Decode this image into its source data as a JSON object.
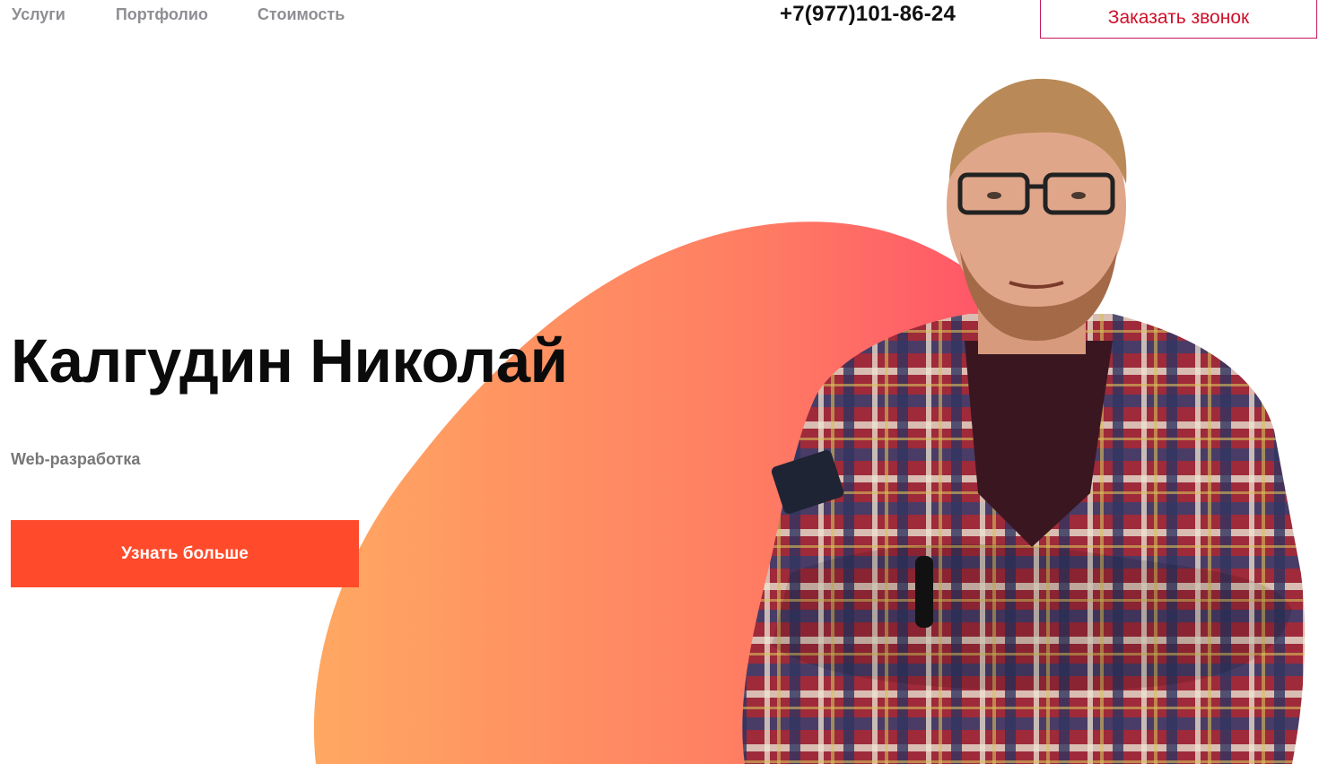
{
  "nav": {
    "items": [
      {
        "label": "Услуги"
      },
      {
        "label": "Портфолио"
      },
      {
        "label": "Стоимость"
      }
    ]
  },
  "header": {
    "phone": "+7(977)101-86-24",
    "callback_label": "Заказать звонок"
  },
  "hero": {
    "title": "Калгудин Николай",
    "subtitle": "Web-разработка",
    "cta_label": "Узнать больше"
  },
  "colors": {
    "accent": "#ff4b2b",
    "blob_start": "#ffa25c",
    "blob_end": "#ff1f6e",
    "callback_text": "#d0102a",
    "nav_text": "#8e8e93"
  },
  "icons": {
    "portrait": "person-photo"
  }
}
